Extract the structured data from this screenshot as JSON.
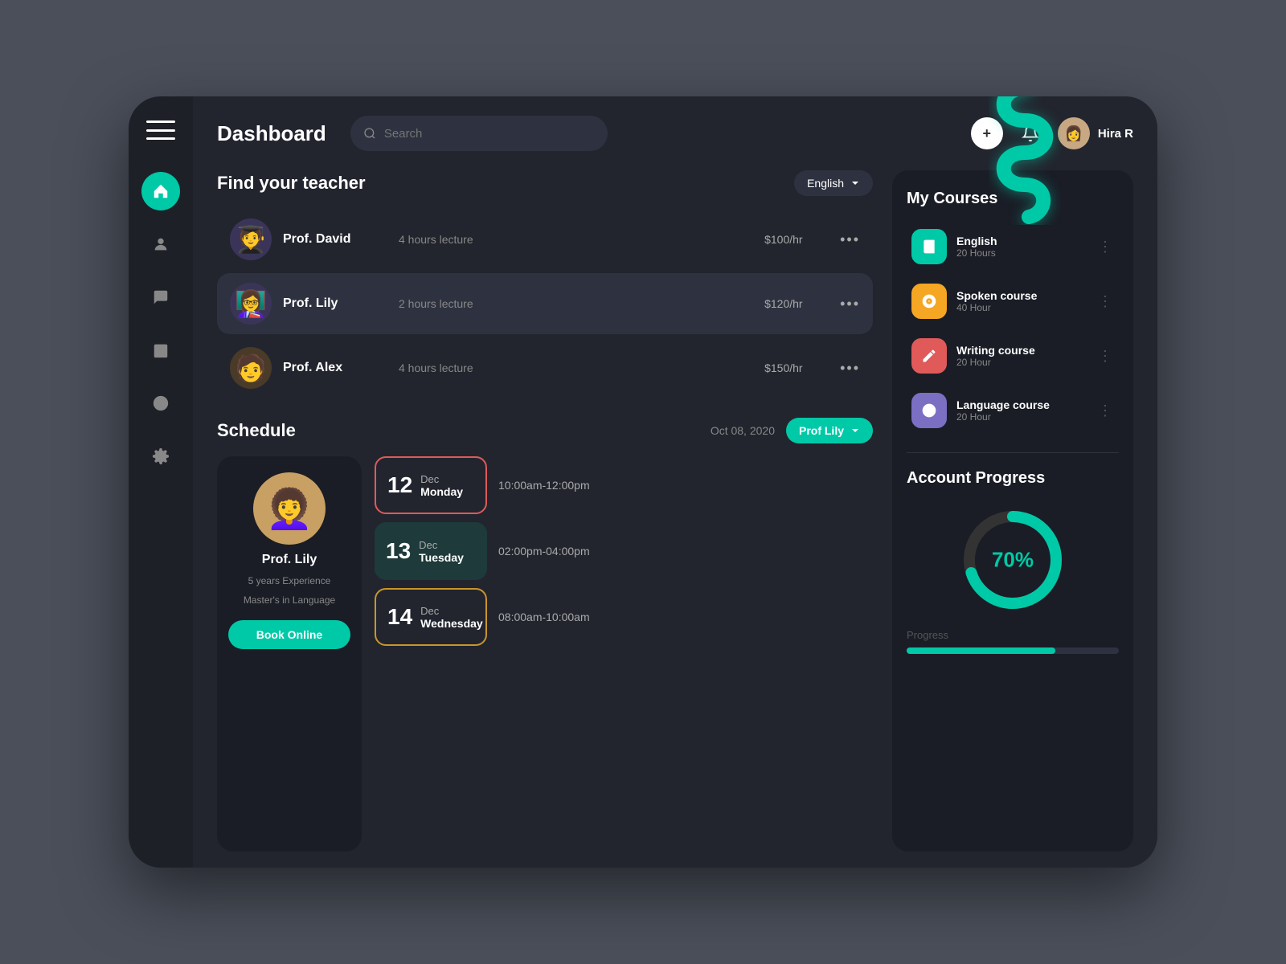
{
  "header": {
    "title": "Dashboard",
    "search_placeholder": "Search",
    "user_name": "Hira R",
    "add_label": "+",
    "date": "Oct 08, 2020"
  },
  "find_teacher": {
    "title": "Find your teacher",
    "filter": "English",
    "teachers": [
      {
        "name": "Prof. David",
        "detail": "4 hours lecture",
        "price": "$100/hr",
        "avatar": "🧑",
        "active": false
      },
      {
        "name": "Prof. Lily",
        "detail": "2 hours lecture",
        "price": "$120/hr",
        "avatar": "👩",
        "active": true
      },
      {
        "name": "Prof. Alex",
        "detail": "4 hours lecture",
        "price": "$150/hr",
        "avatar": "🧑",
        "active": false
      }
    ]
  },
  "schedule": {
    "title": "Schedule",
    "date": "Oct 08, 2020",
    "prof": "Prof Lily",
    "prof_card": {
      "name": "Prof. Lily",
      "experience": "5 years Experience",
      "degree": "Master's in Language",
      "book_label": "Book Online"
    },
    "items": [
      {
        "day_num": "12",
        "month": "Dec",
        "weekday": "Monday",
        "time": "10:00am-12:00pm",
        "style": "outline-red"
      },
      {
        "day_num": "13",
        "month": "Dec",
        "weekday": "Tuesday",
        "time": "02:00pm-04:00pm",
        "style": "filled-dark"
      },
      {
        "day_num": "14",
        "month": "Dec",
        "weekday": "Wednesday",
        "time": "08:00am-10:00am",
        "style": "outline-gold"
      }
    ]
  },
  "my_courses": {
    "title": "My Courses",
    "courses": [
      {
        "name": "English",
        "hours": "20 Hours",
        "icon_color": "teal",
        "icon": "📖"
      },
      {
        "name": "Spoken course",
        "hours": "40 Hour",
        "icon_color": "orange",
        "icon": "🎤"
      },
      {
        "name": "Writing course",
        "hours": "20 Hour",
        "icon_color": "red",
        "icon": "✏️"
      },
      {
        "name": "Language course",
        "hours": "20 Hour",
        "icon_color": "purple",
        "icon": "🌐"
      }
    ]
  },
  "account_progress": {
    "title": "Account Progress",
    "percent": 70,
    "percent_label": "70%",
    "progress_label": "Progress"
  },
  "sidebar": {
    "nav_items": [
      {
        "icon": "home",
        "active": true
      },
      {
        "icon": "user",
        "active": false
      },
      {
        "icon": "chat",
        "active": false
      },
      {
        "icon": "calendar",
        "active": false
      },
      {
        "icon": "clock",
        "active": false
      },
      {
        "icon": "gear",
        "active": false
      }
    ]
  }
}
